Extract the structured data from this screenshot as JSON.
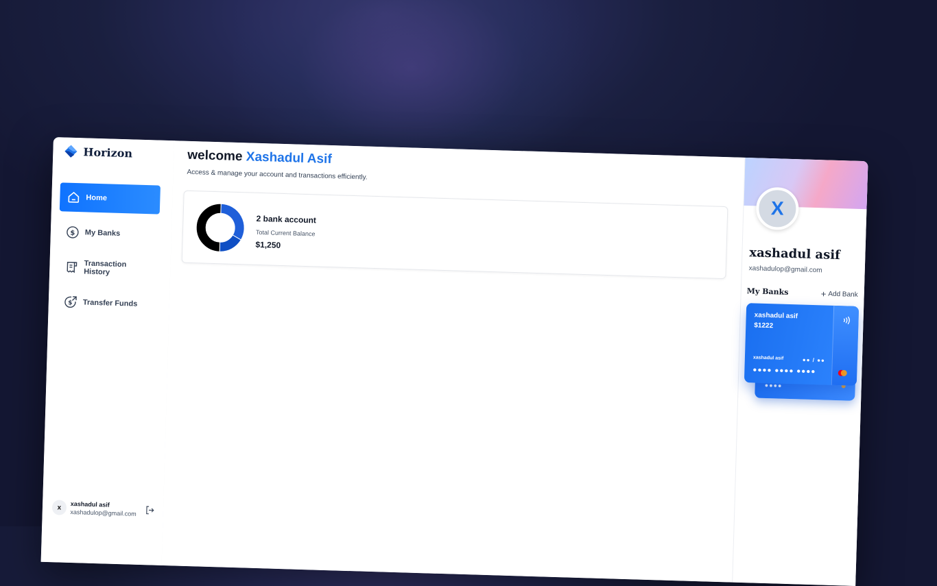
{
  "sidebar": {
    "logo_text": "Horizon",
    "items": [
      {
        "label": "Home",
        "icon": "home-icon",
        "active": true
      },
      {
        "label": "My Banks",
        "icon": "dollar-circle-icon",
        "active": false
      },
      {
        "label": "Transaction History",
        "icon": "receipt-icon",
        "active": false
      },
      {
        "label": "Transfer Funds",
        "icon": "money-send-icon",
        "active": false
      }
    ],
    "footer": {
      "avatar_initial": "x",
      "name": "xashadul asif",
      "email": "xashadulop@gmail.com",
      "logout_icon": "logout-icon"
    }
  },
  "header": {
    "welcome_prefix": "welcome",
    "user_name": "Xashadul Asif",
    "subtitle": "Access & manage your account and transactions efficiently."
  },
  "balance": {
    "bank_count_text": "2 bank account",
    "label": "Total Current Balance",
    "amount": "$1,250",
    "chart_data": {
      "type": "pie",
      "values": [
        33,
        17,
        50
      ],
      "colors": [
        "#1f5fd9",
        "#0f4fc4",
        "#000000"
      ]
    }
  },
  "profile": {
    "avatar_initial": "X",
    "name": "xashadul asif",
    "email": "xashadulop@gmail.com",
    "banner_colors": [
      "#bcd3ff",
      "#f5a8c8",
      "#d2a6f2"
    ]
  },
  "my_banks": {
    "title": "My Banks",
    "add_label": "Add Bank",
    "card": {
      "holder": "xashadul asif",
      "balance": "$1222",
      "name_small": "xashadul asif",
      "expiry": "●● / ●●",
      "number": "●●●● ●●●● ●●●●",
      "contactless_icon": "contactless-icon",
      "network_icon": "mastercard-icon"
    },
    "card_back": {
      "number": "●●●●"
    }
  }
}
